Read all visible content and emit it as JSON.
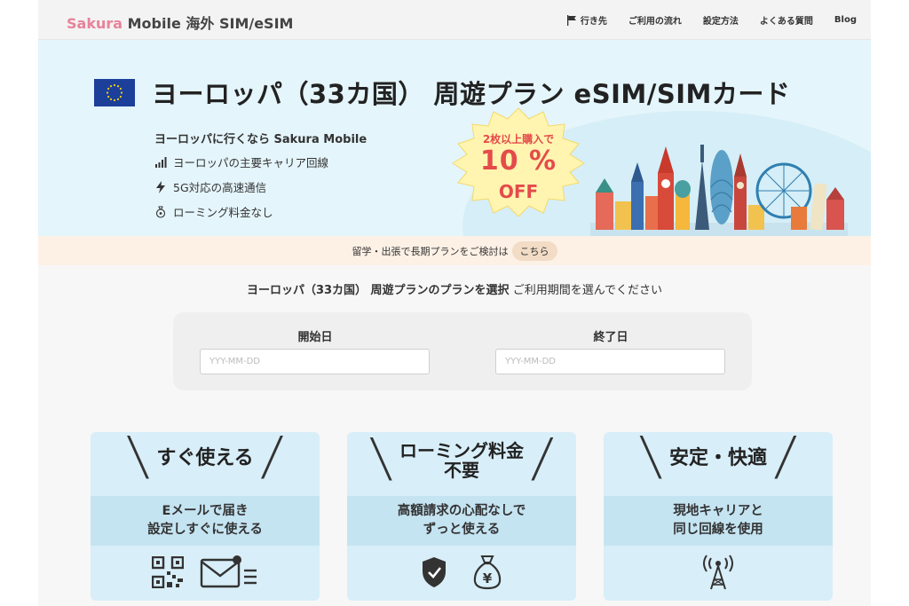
{
  "header": {
    "logo_brand_1": "Sakura",
    "logo_brand_2": "Mobile",
    "logo_suffix": "海外 SIM/eSIM",
    "nav": [
      {
        "label": "行き先"
      },
      {
        "label": "ご利用の流れ"
      },
      {
        "label": "設定方法"
      },
      {
        "label": "よくある質問"
      },
      {
        "label": "Blog"
      }
    ]
  },
  "hero": {
    "title": "ヨーロッパ（33カ国） 周遊プラン eSIM/SIMカード",
    "subtitle": "ヨーロッパに行くなら Sakura Mobile",
    "features": [
      {
        "icon": "signal-bars-icon",
        "text": "ヨーロッパの主要キャリア回線"
      },
      {
        "icon": "lightning-icon",
        "text": "5G対応の高速通信"
      },
      {
        "icon": "coin-bag-icon",
        "text": "ローミング料金なし"
      }
    ],
    "badge": {
      "line1": "2枚以上購入で",
      "line2": "10 %",
      "line3": "OFF"
    }
  },
  "strip": {
    "text": "留学・出張で長期プランをご検討は",
    "link": "こちら"
  },
  "plan_select": {
    "heading_bold": "ヨーロッパ（33カ国） 周遊プランのプランを選択",
    "heading_rest": "ご利用期間を選んでください",
    "start_label": "開始日",
    "end_label": "終了日",
    "start_placeholder": "YYY-MM-DD",
    "end_placeholder": "YYY-MM-DD"
  },
  "cards": [
    {
      "title": "すぐ使える",
      "body": "Eメールで届き\n設定しすぐに使える",
      "icons": [
        "qr-code-icon",
        "mail-icon"
      ]
    },
    {
      "title": "ローミング料金\n不要",
      "body": "高額請求の心配なしで\nずっと使える",
      "icons": [
        "shield-check-icon",
        "yen-bag-icon"
      ]
    },
    {
      "title": "安定・快適",
      "body": "現地キャリアと\n同じ回線を使用",
      "icons": [
        "antenna-tower-icon"
      ]
    }
  ],
  "colors": {
    "hero_bg": "#e4f5fb",
    "card_bg": "#d8eef8",
    "badge_red": "#e54b4b",
    "badge_yellow": "#fff5b0",
    "logo_pink": "#e8829a"
  }
}
